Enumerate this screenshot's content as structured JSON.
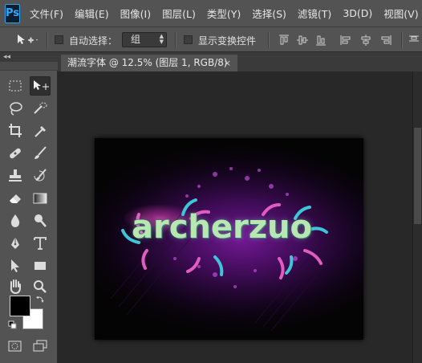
{
  "app": {
    "logo": "Ps"
  },
  "menu": [
    "文件(F)",
    "编辑(E)",
    "图像(I)",
    "图层(L)",
    "类型(Y)",
    "选择(S)",
    "滤镜(T)",
    "3D(D)",
    "视图(V)"
  ],
  "options": {
    "auto_select_label": "自动选择：",
    "auto_select_value": "组",
    "show_transform_label": "显示变换控件"
  },
  "panel": {
    "collapse": "◂◂"
  },
  "document": {
    "tab_title": "潮流字体 @ 12.5% (图层 1, RGB/8)",
    "close": "×",
    "art_text": "archerzuo"
  },
  "colors": {
    "foreground": "#000000",
    "background": "#ffffff",
    "accent": "#31a8ff",
    "glow": "#8a1fb0"
  },
  "tools": [
    "rect-marquee-icon",
    "move-icon",
    "lasso-icon",
    "quick-select-icon",
    "crop-icon",
    "eyedropper-icon",
    "healing-brush-icon",
    "brush-icon",
    "clone-stamp-icon",
    "history-brush-icon",
    "eraser-icon",
    "gradient-icon",
    "blur-icon",
    "dodge-icon",
    "pen-icon",
    "type-icon",
    "path-select-icon",
    "rectangle-shape-icon",
    "hand-icon",
    "zoom-icon"
  ]
}
